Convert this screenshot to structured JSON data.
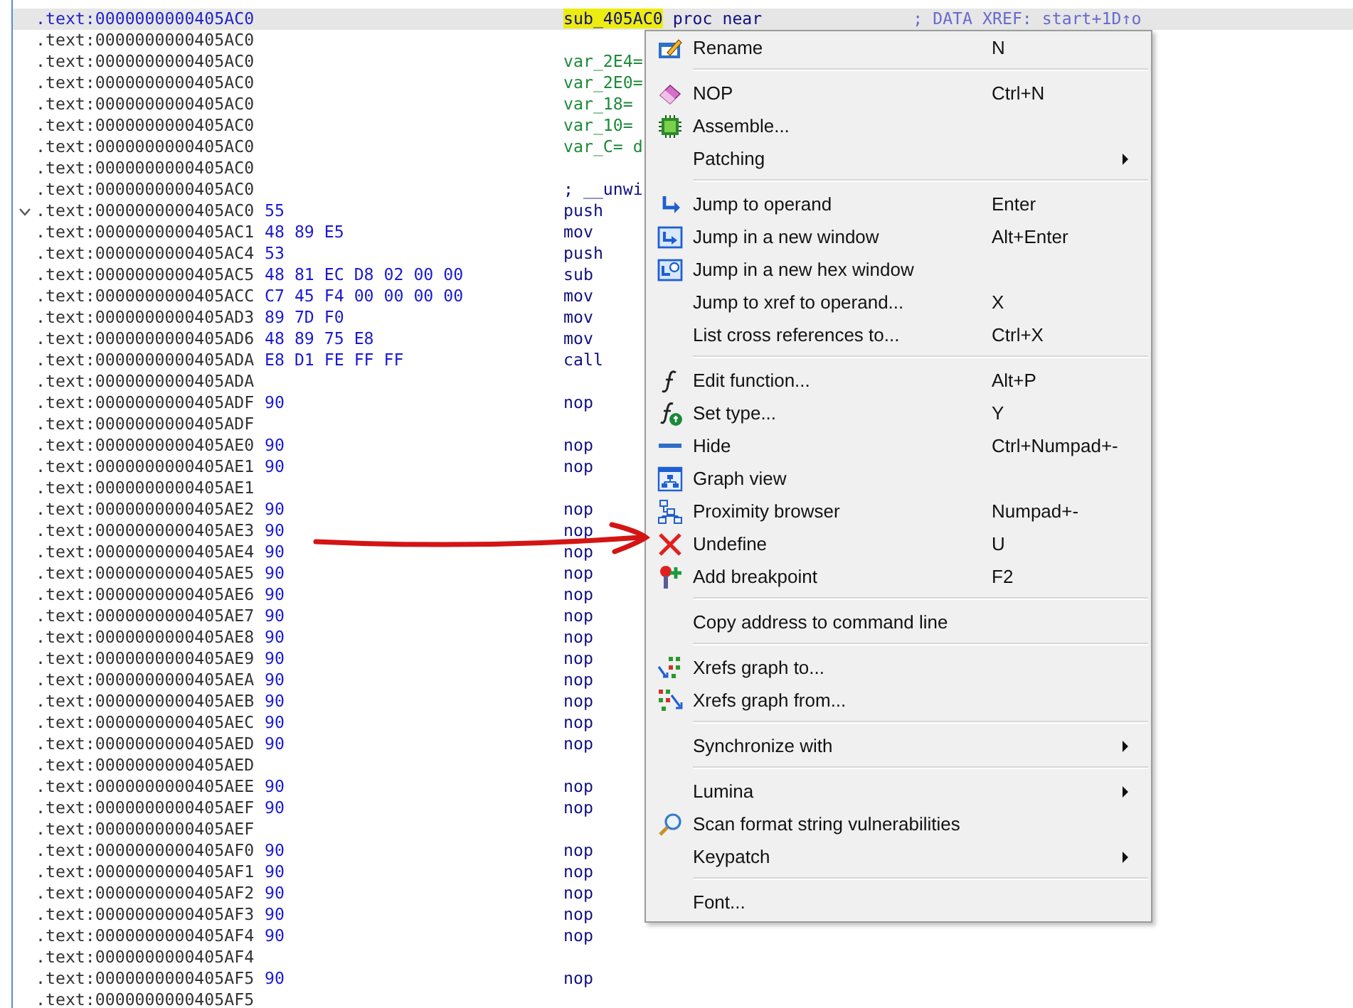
{
  "listing": {
    "rows": [
      {
        "address": ".text:0000000000405AC0",
        "kind": "label",
        "name": "sub_405AC0",
        "text": "proc near",
        "comment": "; DATA XREF: start+1D↑o",
        "selected": true
      },
      {
        "address": ".text:0000000000405AC0",
        "kind": "blank",
        "selected": false
      },
      {
        "address": ".text:0000000000405AC0",
        "kind": "var",
        "text": "var_2E4=",
        "selected": false
      },
      {
        "address": ".text:0000000000405AC0",
        "kind": "var",
        "text": "var_2E0=",
        "selected": false
      },
      {
        "address": ".text:0000000000405AC0",
        "kind": "var",
        "text": "var_18=",
        "selected": false
      },
      {
        "address": ".text:0000000000405AC0",
        "kind": "var",
        "text": "var_10=",
        "selected": false
      },
      {
        "address": ".text:0000000000405AC0",
        "kind": "var",
        "text": "var_C= d",
        "selected": false
      },
      {
        "address": ".text:0000000000405AC0",
        "kind": "blank",
        "selected": false
      },
      {
        "address": ".text:0000000000405AC0",
        "kind": "comment",
        "text": "; __unwi",
        "selected": false
      },
      {
        "address": ".text:0000000000405AC0",
        "kind": "code",
        "bytes": "55",
        "text": "push",
        "expanded": true,
        "selected": false
      },
      {
        "address": ".text:0000000000405AC1",
        "kind": "code",
        "bytes": "48 89 E5",
        "text": "mov",
        "selected": false
      },
      {
        "address": ".text:0000000000405AC4",
        "kind": "code",
        "bytes": "53",
        "text": "push",
        "selected": false
      },
      {
        "address": ".text:0000000000405AC5",
        "kind": "code",
        "bytes": "48 81 EC D8 02 00 00",
        "text": "sub",
        "selected": false
      },
      {
        "address": ".text:0000000000405ACC",
        "kind": "code",
        "bytes": "C7 45 F4 00 00 00 00",
        "text": "mov",
        "selected": false
      },
      {
        "address": ".text:0000000000405AD3",
        "kind": "code",
        "bytes": "89 7D F0",
        "text": "mov",
        "selected": false
      },
      {
        "address": ".text:0000000000405AD6",
        "kind": "code",
        "bytes": "48 89 75 E8",
        "text": "mov",
        "selected": false
      },
      {
        "address": ".text:0000000000405ADA",
        "kind": "code",
        "bytes": "E8 D1 FE FF FF",
        "text": "call",
        "selected": false
      },
      {
        "address": ".text:0000000000405ADA",
        "kind": "blank",
        "selected": false
      },
      {
        "address": ".text:0000000000405ADF",
        "kind": "code",
        "bytes": "90",
        "text": "nop",
        "selected": false
      },
      {
        "address": ".text:0000000000405ADF",
        "kind": "blank",
        "selected": false
      },
      {
        "address": ".text:0000000000405AE0",
        "kind": "code",
        "bytes": "90",
        "text": "nop",
        "selected": false
      },
      {
        "address": ".text:0000000000405AE1",
        "kind": "code",
        "bytes": "90",
        "text": "nop",
        "selected": false
      },
      {
        "address": ".text:0000000000405AE1",
        "kind": "blank",
        "selected": false
      },
      {
        "address": ".text:0000000000405AE2",
        "kind": "code",
        "bytes": "90",
        "text": "nop",
        "selected": false
      },
      {
        "address": ".text:0000000000405AE3",
        "kind": "code",
        "bytes": "90",
        "text": "nop",
        "selected": false
      },
      {
        "address": ".text:0000000000405AE4",
        "kind": "code",
        "bytes": "90",
        "text": "nop",
        "selected": false
      },
      {
        "address": ".text:0000000000405AE5",
        "kind": "code",
        "bytes": "90",
        "text": "nop",
        "selected": false
      },
      {
        "address": ".text:0000000000405AE6",
        "kind": "code",
        "bytes": "90",
        "text": "nop",
        "selected": false
      },
      {
        "address": ".text:0000000000405AE7",
        "kind": "code",
        "bytes": "90",
        "text": "nop",
        "selected": false
      },
      {
        "address": ".text:0000000000405AE8",
        "kind": "code",
        "bytes": "90",
        "text": "nop",
        "selected": false
      },
      {
        "address": ".text:0000000000405AE9",
        "kind": "code",
        "bytes": "90",
        "text": "nop",
        "selected": false
      },
      {
        "address": ".text:0000000000405AEA",
        "kind": "code",
        "bytes": "90",
        "text": "nop",
        "selected": false
      },
      {
        "address": ".text:0000000000405AEB",
        "kind": "code",
        "bytes": "90",
        "text": "nop",
        "selected": false
      },
      {
        "address": ".text:0000000000405AEC",
        "kind": "code",
        "bytes": "90",
        "text": "nop",
        "selected": false
      },
      {
        "address": ".text:0000000000405AED",
        "kind": "code",
        "bytes": "90",
        "text": "nop",
        "selected": false
      },
      {
        "address": ".text:0000000000405AED",
        "kind": "blank",
        "selected": false
      },
      {
        "address": ".text:0000000000405AEE",
        "kind": "code",
        "bytes": "90",
        "text": "nop",
        "selected": false
      },
      {
        "address": ".text:0000000000405AEF",
        "kind": "code",
        "bytes": "90",
        "text": "nop",
        "selected": false
      },
      {
        "address": ".text:0000000000405AEF",
        "kind": "blank",
        "selected": false
      },
      {
        "address": ".text:0000000000405AF0",
        "kind": "code",
        "bytes": "90",
        "text": "nop",
        "selected": false
      },
      {
        "address": ".text:0000000000405AF1",
        "kind": "code",
        "bytes": "90",
        "text": "nop",
        "selected": false
      },
      {
        "address": ".text:0000000000405AF2",
        "kind": "code",
        "bytes": "90",
        "text": "nop",
        "selected": false
      },
      {
        "address": ".text:0000000000405AF3",
        "kind": "code",
        "bytes": "90",
        "text": "nop",
        "selected": false
      },
      {
        "address": ".text:0000000000405AF4",
        "kind": "code",
        "bytes": "90",
        "text": "nop",
        "selected": false
      },
      {
        "address": ".text:0000000000405AF4",
        "kind": "blank",
        "selected": false
      },
      {
        "address": ".text:0000000000405AF5",
        "kind": "code",
        "bytes": "90",
        "text": "nop",
        "selected": false
      },
      {
        "address": ".text:0000000000405AF5",
        "kind": "blank",
        "selected": false
      }
    ]
  },
  "context_menu": {
    "sections": [
      [
        {
          "label": "Rename",
          "shortcut": "N",
          "submenu": false
        }
      ],
      [
        {
          "label": "NOP",
          "shortcut": "Ctrl+N",
          "submenu": false
        },
        {
          "label": "Assemble...",
          "submenu": false
        },
        {
          "label": "Patching",
          "submenu": true
        }
      ],
      [
        {
          "label": "Jump to operand",
          "shortcut": "Enter",
          "submenu": false
        },
        {
          "label": "Jump in a new window",
          "shortcut": "Alt+Enter",
          "submenu": false
        },
        {
          "label": "Jump in a new hex window",
          "submenu": false
        },
        {
          "label": "Jump to xref to operand...",
          "shortcut": "X",
          "submenu": false
        },
        {
          "label": "List cross references to...",
          "shortcut": "Ctrl+X",
          "submenu": false
        }
      ],
      [
        {
          "label": "Edit function...",
          "shortcut": "Alt+P",
          "submenu": false
        },
        {
          "label": "Set type...",
          "shortcut": "Y",
          "submenu": false
        },
        {
          "label": "Hide",
          "shortcut": "Ctrl+Numpad+-",
          "submenu": false
        },
        {
          "label": "Graph view",
          "submenu": false
        },
        {
          "label": "Proximity browser",
          "shortcut": "Numpad+-",
          "submenu": false
        },
        {
          "label": "Undefine",
          "shortcut": "U",
          "submenu": false
        },
        {
          "label": "Add breakpoint",
          "shortcut": "F2",
          "submenu": false
        }
      ],
      [
        {
          "label": "Copy address to command line",
          "submenu": false
        }
      ],
      [
        {
          "label": "Xrefs graph to...",
          "submenu": false
        },
        {
          "label": "Xrefs graph from...",
          "submenu": false
        }
      ],
      [
        {
          "label": "Synchronize with",
          "submenu": true
        }
      ],
      [
        {
          "label": "Lumina",
          "submenu": true
        },
        {
          "label": "Scan format string vulnerabilities",
          "submenu": false
        },
        {
          "label": "Keypatch",
          "submenu": true
        }
      ],
      [
        {
          "label": "Font...",
          "submenu": false
        }
      ]
    ]
  }
}
